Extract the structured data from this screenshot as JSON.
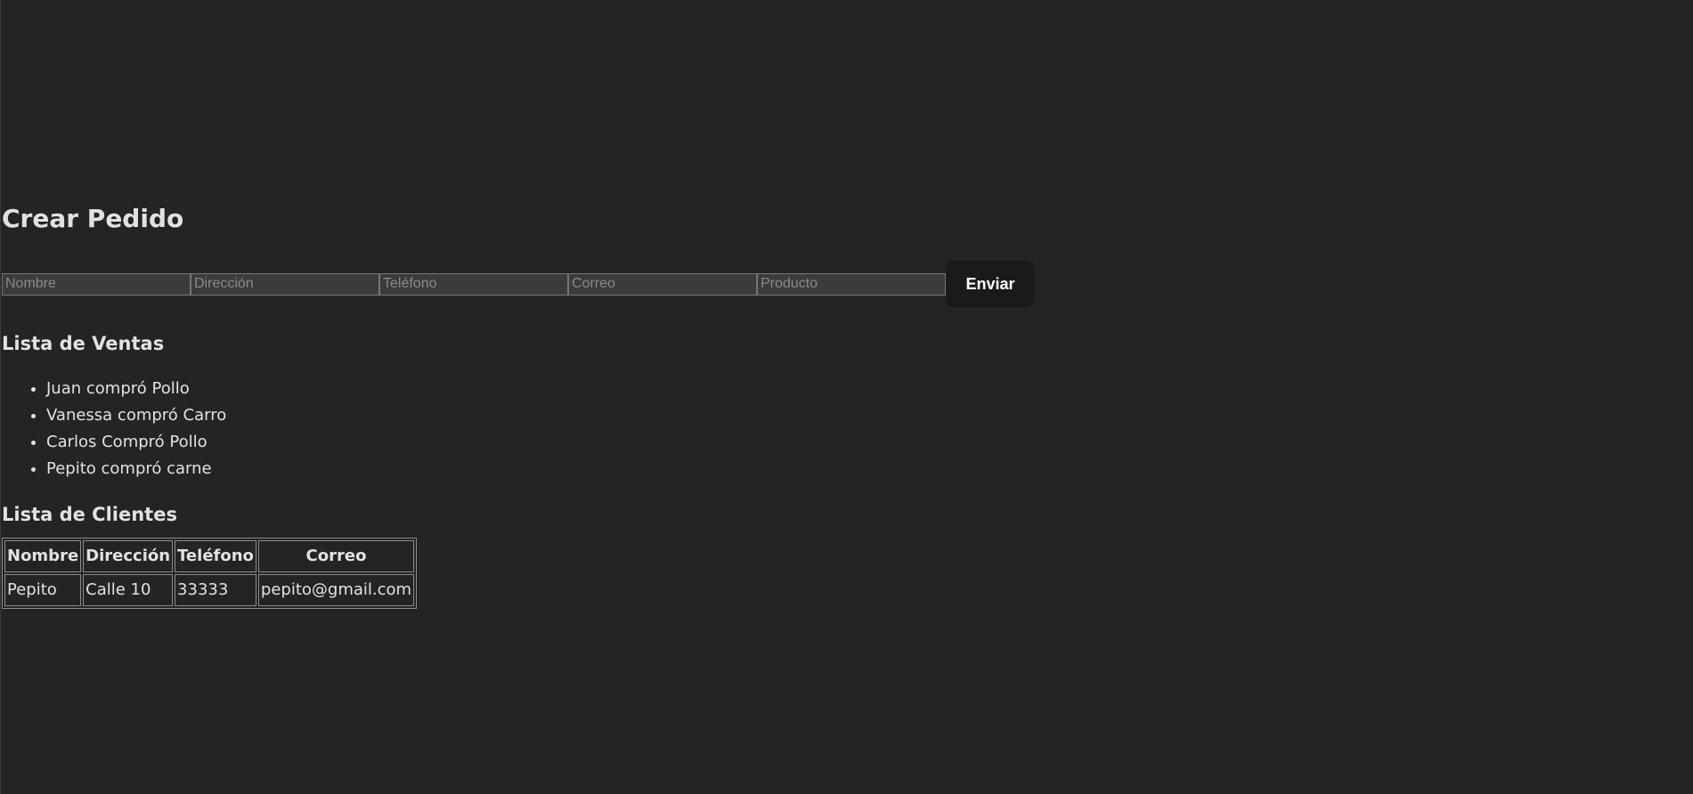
{
  "page": {
    "title": "Crear Pedido"
  },
  "form": {
    "fields": [
      {
        "placeholder": "Nombre",
        "value": ""
      },
      {
        "placeholder": "Dirección",
        "value": ""
      },
      {
        "placeholder": "Teléfono",
        "value": ""
      },
      {
        "placeholder": "Correo",
        "value": ""
      },
      {
        "placeholder": "Producto",
        "value": ""
      }
    ],
    "submit_label": "Enviar"
  },
  "sales": {
    "title": "Lista de Ventas",
    "items": [
      "Juan compró Pollo",
      "Vanessa compró Carro",
      "Carlos Compró Pollo",
      "Pepito compró carne"
    ]
  },
  "clients": {
    "title": "Lista de Clientes",
    "columns": [
      "Nombre",
      "Dirección",
      "Teléfono",
      "Correo"
    ],
    "rows": [
      [
        "Pepito",
        "Calle 10",
        "33333",
        "pepito@gmail.com"
      ]
    ]
  },
  "colors": {
    "background": "#242424",
    "text": "#dedede",
    "button_bg": "#1a1a1a",
    "input_bg": "#3b3b3b",
    "border": "#8c8c8c"
  }
}
